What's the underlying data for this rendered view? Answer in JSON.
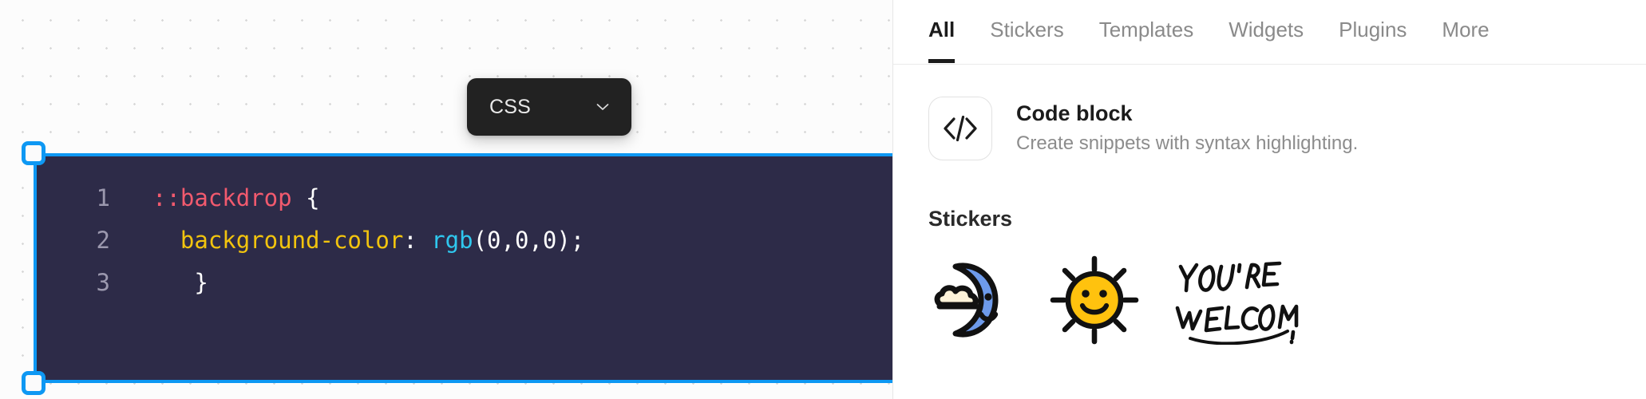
{
  "canvas": {
    "language_selector": {
      "label": "CSS",
      "chevron_icon": "chevron-down-icon"
    },
    "code_block": {
      "lines": [
        {
          "number": "1",
          "indent": "",
          "tokens": [
            {
              "text": "::backdrop",
              "type": "selector"
            },
            {
              "text": " {",
              "type": "punctuation"
            }
          ]
        },
        {
          "number": "2",
          "indent": "  ",
          "tokens": [
            {
              "text": "background-color",
              "type": "property"
            },
            {
              "text": ": ",
              "type": "punctuation"
            },
            {
              "text": "rgb",
              "type": "function"
            },
            {
              "text": "(0,0,0);",
              "type": "punctuation"
            }
          ]
        },
        {
          "number": "3",
          "indent": "   ",
          "tokens": [
            {
              "text": "}",
              "type": "punctuation"
            }
          ]
        }
      ],
      "background_color": "#2d2b48",
      "selection_color": "#0e98f3",
      "gutter_color": "#9b98ae",
      "token_colors": {
        "selector": "#f25a6e",
        "property": "#f2c40e",
        "function": "#2fc7ee",
        "punctuation": "#ffffff"
      }
    },
    "selection_handles": [
      "top-left",
      "bottom-left"
    ]
  },
  "panel": {
    "tabs": [
      {
        "label": "All",
        "active": true
      },
      {
        "label": "Stickers",
        "active": false
      },
      {
        "label": "Templates",
        "active": false
      },
      {
        "label": "Widgets",
        "active": false
      },
      {
        "label": "Plugins",
        "active": false
      },
      {
        "label": "More",
        "active": false
      }
    ],
    "result": {
      "icon": "code-brackets-icon",
      "title": "Code block",
      "subtitle": "Create snippets with syntax highlighting."
    },
    "stickers_section": {
      "heading": "Stickers",
      "items": [
        {
          "name": "crescent-moon-with-cloud-sticker",
          "colors": {
            "fill": "#6d9aea",
            "cloud": "#fdf2d8",
            "outline": "#111111"
          }
        },
        {
          "name": "smiling-sun-sticker",
          "colors": {
            "fill": "#ffc20e",
            "outline": "#111111"
          }
        },
        {
          "name": "youre-welcome-text-sticker",
          "text_line1": "YOU'RE",
          "text_line2": "WELCOME!",
          "colors": {
            "outline": "#111111"
          }
        }
      ]
    }
  }
}
